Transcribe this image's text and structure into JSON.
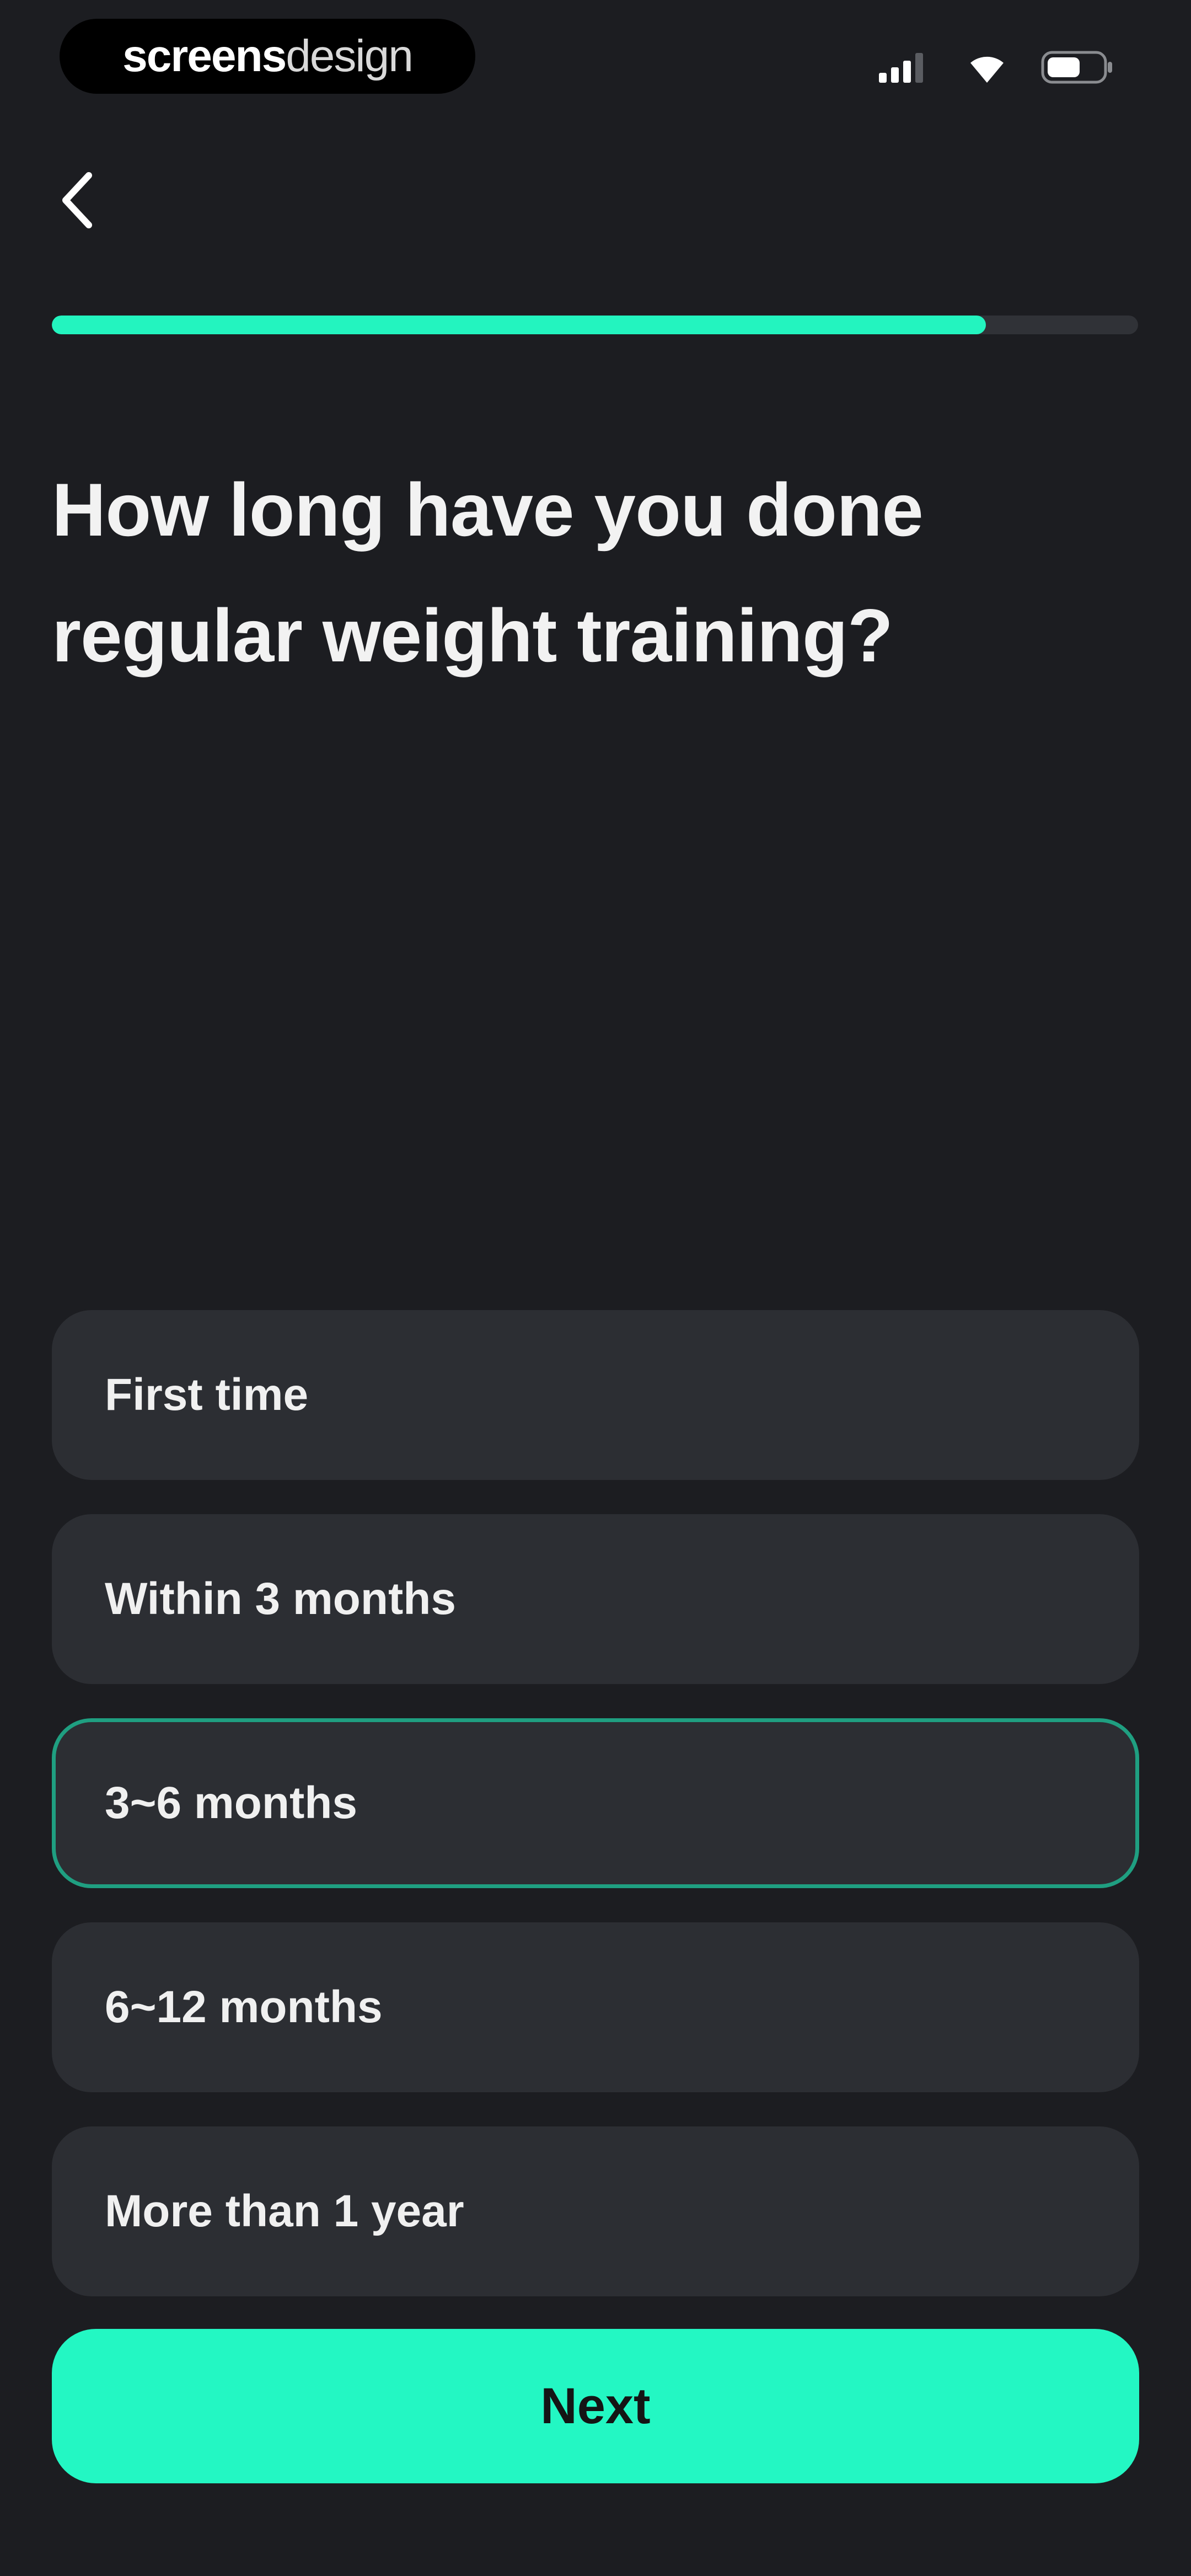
{
  "status_bar": {
    "brand_bold": "screens",
    "brand_light": "design",
    "icons": [
      "signal-icon",
      "wifi-icon",
      "battery-icon"
    ]
  },
  "navigation": {
    "back_icon": "chevron-left-icon"
  },
  "progress": {
    "fraction": 0.86,
    "fill_color": "#23f4bf",
    "track_color": "#303237"
  },
  "question": {
    "line1": "How long have you done",
    "line2": "regular weight training?"
  },
  "options": [
    {
      "label": "First time",
      "selected": false
    },
    {
      "label": "Within 3 months",
      "selected": false
    },
    {
      "label": "3~6 months",
      "selected": true
    },
    {
      "label": "6~12 months",
      "selected": false
    },
    {
      "label": "More than 1 year",
      "selected": false
    }
  ],
  "next_button": {
    "label": "Next"
  },
  "colors": {
    "background": "#1c1d21",
    "accent": "#23f7c3",
    "option_background": "#2c2e33",
    "selected_border": "#1f9f81"
  }
}
